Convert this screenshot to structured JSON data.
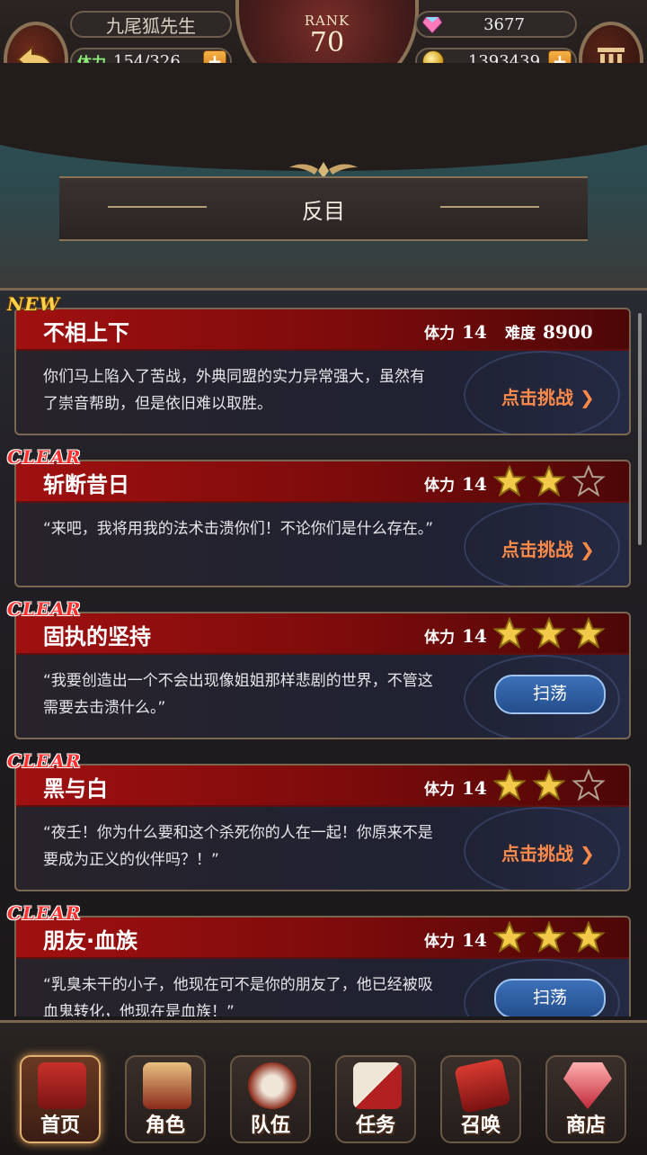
{
  "header": {
    "player_name": "九尾狐先生",
    "stamina_label": "体力",
    "stamina_value": "154/326",
    "rank_label": "RANK",
    "rank_value": "70",
    "gems": "3677",
    "coins": "1393439",
    "plus_label": "+"
  },
  "chapter": {
    "title": "反目"
  },
  "stages": [
    {
      "tag": "NEW",
      "name": "不相上下",
      "stamina_label": "体力",
      "stamina": "14",
      "difficulty_label": "难度",
      "difficulty": "8900",
      "desc": "你们马上陷入了苦战，外典同盟的实力异常强大，虽然有了崇音帮助，但是依旧难以取胜。",
      "action": "点击挑战 ❯",
      "action_type": "challenge"
    },
    {
      "tag": "CLEAR",
      "name": "斩断昔日",
      "stamina_label": "体力",
      "stamina": "14",
      "stars": 2,
      "desc": "“来吧，我将用我的法术击溃你们！不论你们是什么存在。”",
      "action": "点击挑战 ❯",
      "action_type": "challenge"
    },
    {
      "tag": "CLEAR",
      "name": "固执的坚持",
      "stamina_label": "体力",
      "stamina": "14",
      "stars": 3,
      "desc": "“我要创造出一个不会出现像姐姐那样悲剧的世界，不管这需要去击溃什么。”",
      "action": "扫荡",
      "action_type": "sweep"
    },
    {
      "tag": "CLEAR",
      "name": "黑与白",
      "stamina_label": "体力",
      "stamina": "14",
      "stars": 2,
      "desc": "“夜壬！你为什么要和这个杀死你的人在一起！你原来不是要成为正义的伙伴吗？！”",
      "action": "点击挑战 ❯",
      "action_type": "challenge"
    },
    {
      "tag": "CLEAR",
      "name": "朋友·血族",
      "stamina_label": "体力",
      "stamina": "14",
      "stars": 3,
      "desc": "“乳臭未干的小子，他现在可不是你的朋友了，他已经被吸血鬼转化，他现在是血族！”",
      "action": "扫荡",
      "action_type": "sweep"
    }
  ],
  "nav": [
    {
      "label": "首页",
      "icon": "home-icon",
      "active": true
    },
    {
      "label": "角色",
      "icon": "character-icon"
    },
    {
      "label": "队伍",
      "icon": "team-icon"
    },
    {
      "label": "任务",
      "icon": "quest-icon"
    },
    {
      "label": "召唤",
      "icon": "summon-icon"
    },
    {
      "label": "商店",
      "icon": "shop-icon"
    }
  ],
  "colors": {
    "accent_red": "#a01010",
    "challenge_orange": "#ff8a4a",
    "stamina_green": "#8ef07a",
    "star_gold": "#f3c94a"
  }
}
